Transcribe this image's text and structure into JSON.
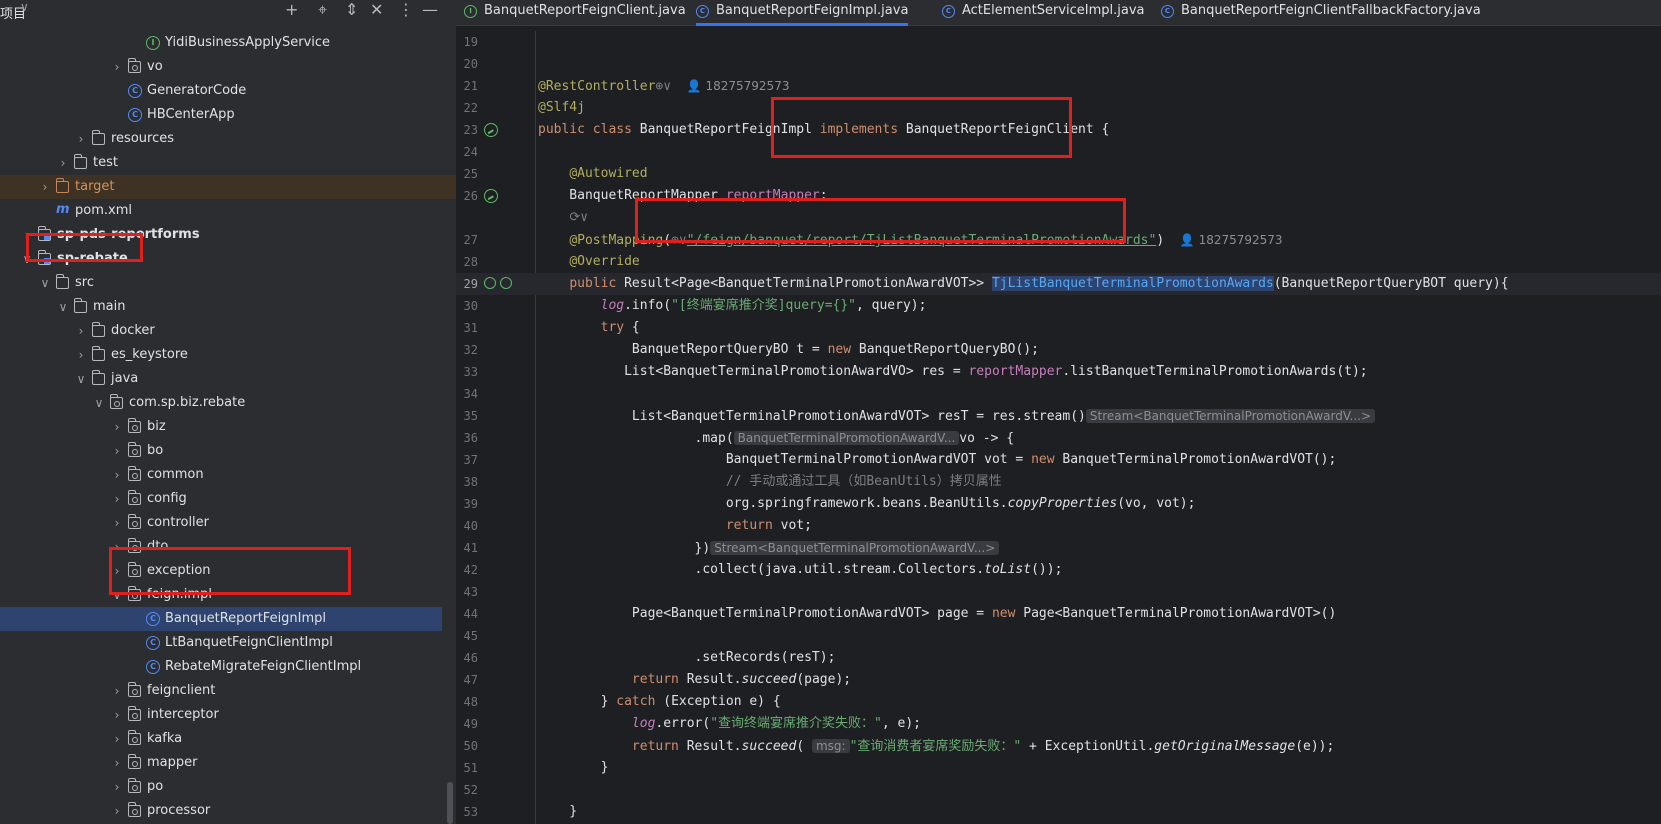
{
  "project": {
    "title": "项目",
    "title_chevron": "∨",
    "header_buttons": [
      "+",
      "⌖",
      "⇕",
      "✕",
      "⋮",
      "—"
    ],
    "tree": [
      {
        "label": "YidiBusinessApplyService",
        "icon": "interface-icon",
        "level": 8,
        "chevron": ""
      },
      {
        "label": "vo",
        "icon": "package-icon",
        "level": 7,
        "chevron": "›"
      },
      {
        "label": "GeneratorCode",
        "icon": "class-icon",
        "level": 7,
        "chevron": ""
      },
      {
        "label": "HBCenterApp",
        "icon": "class-icon",
        "level": 7,
        "chevron": ""
      },
      {
        "label": "resources",
        "icon": "folder-icon",
        "level": 5,
        "chevron": "›"
      },
      {
        "label": "test",
        "icon": "folder-icon",
        "level": 4,
        "chevron": "›"
      },
      {
        "label": "target",
        "icon": "target-folder-icon",
        "level": 3,
        "chevron": "›"
      },
      {
        "label": "pom.xml",
        "icon": "maven-icon",
        "level": 3,
        "chevron": ""
      },
      {
        "label": "sp-pds-reportforms",
        "icon": "module-icon",
        "level": 2,
        "chevron": "›"
      },
      {
        "label": "sp-rebate",
        "icon": "module-icon",
        "level": 2,
        "chevron": "∨"
      },
      {
        "label": "src",
        "icon": "folder-icon",
        "level": 3,
        "chevron": "∨"
      },
      {
        "label": "main",
        "icon": "folder-icon",
        "level": 4,
        "chevron": "∨"
      },
      {
        "label": "docker",
        "icon": "folder-icon",
        "level": 5,
        "chevron": "›"
      },
      {
        "label": "es_keystore",
        "icon": "folder-icon",
        "level": 5,
        "chevron": "›"
      },
      {
        "label": "java",
        "icon": "folder-icon",
        "level": 5,
        "chevron": "∨"
      },
      {
        "label": "com.sp.biz.rebate",
        "icon": "package-icon",
        "level": 6,
        "chevron": "∨"
      },
      {
        "label": "biz",
        "icon": "package-icon",
        "level": 7,
        "chevron": "›"
      },
      {
        "label": "bo",
        "icon": "package-icon",
        "level": 7,
        "chevron": "›"
      },
      {
        "label": "common",
        "icon": "package-icon",
        "level": 7,
        "chevron": "›"
      },
      {
        "label": "config",
        "icon": "package-icon",
        "level": 7,
        "chevron": "›"
      },
      {
        "label": "controller",
        "icon": "package-icon",
        "level": 7,
        "chevron": "›"
      },
      {
        "label": "dto",
        "icon": "package-icon",
        "level": 7,
        "chevron": "›"
      },
      {
        "label": "exception",
        "icon": "package-icon",
        "level": 7,
        "chevron": "›"
      },
      {
        "label": "feign.impl",
        "icon": "package-icon",
        "level": 7,
        "chevron": "∨"
      },
      {
        "label": "BanquetReportFeignImpl",
        "icon": "class-icon",
        "level": 8,
        "chevron": ""
      },
      {
        "label": "LtBanquetFeignClientImpl",
        "icon": "class-icon",
        "level": 8,
        "chevron": ""
      },
      {
        "label": "RebateMigrateFeignClientImpl",
        "icon": "class-icon",
        "level": 8,
        "chevron": ""
      },
      {
        "label": "feignclient",
        "icon": "package-icon",
        "level": 7,
        "chevron": "›"
      },
      {
        "label": "interceptor",
        "icon": "package-icon",
        "level": 7,
        "chevron": "›"
      },
      {
        "label": "kafka",
        "icon": "package-icon",
        "level": 7,
        "chevron": "›"
      },
      {
        "label": "mapper",
        "icon": "package-icon",
        "level": 7,
        "chevron": "›"
      },
      {
        "label": "po",
        "icon": "package-icon",
        "level": 7,
        "chevron": "›"
      },
      {
        "label": "processor",
        "icon": "package-icon",
        "level": 7,
        "chevron": "›"
      }
    ]
  },
  "tabs": [
    {
      "label": "BanquetReportFeignClient.java",
      "icon": "interface-icon",
      "active": false
    },
    {
      "label": "BanquetReportFeignImpl.java",
      "icon": "class-icon",
      "active": true
    },
    {
      "label": "ActElementServiceImpl.java",
      "icon": "class-icon",
      "active": false
    },
    {
      "label": "BanquetReportFeignClientFallbackFactory.java",
      "icon": "class-icon",
      "active": false
    }
  ],
  "code": {
    "author": "18275792573",
    "lines": [
      {
        "n": "19",
        "t": ""
      },
      {
        "n": "20",
        "t": ""
      },
      {
        "n": "21",
        "t": "<span class=\"an\">@RestController</span><span class=\"cm\">⊕∨</span>  <span class=\"author\">👤 18275792573</span>"
      },
      {
        "n": "22",
        "t": "<span class=\"an\">@Slf4j</span>"
      },
      {
        "n": "23",
        "t": "<span class=\"k\">public class</span> BanquetReportFeignImpl <span class=\"k\">implements</span> BanquetReportFeignClient {"
      },
      {
        "n": "24",
        "t": ""
      },
      {
        "n": "25",
        "t": "    <span class=\"an\">@Autowired</span>"
      },
      {
        "n": "26",
        "t": "    BanquetReportMapper <span class=\"f\">reportMapper</span>;"
      },
      {
        "n": "",
        "t": "    <span class=\"cm\">⟳∨</span>"
      },
      {
        "n": "27",
        "t": "    <span class=\"an\">@PostMapping</span>(<span class=\"cm\">⊕∨</span><span class=\"su\">\"/feign/banquet/report/TjListBanquetTerminalPromotionAwards\"</span>)  <span class=\"author\">👤 18275792573</span>"
      },
      {
        "n": "28",
        "t": "    <span class=\"an\">@Override</span>"
      },
      {
        "n": "29",
        "t": "    <span class=\"k\">public</span> Result&lt;Page&lt;BanquetTerminalPromotionAwardVOT&gt;&gt; <span class=\"mh\">TjListBanquetTerminalPromotionAwards</span>(BanquetReportQueryBOT query){"
      },
      {
        "n": "30",
        "t": "        <span class=\"lg\">log</span>.info(<span class=\"s\">\"[终端宴席推介奖]query={}\"</span>, query);"
      },
      {
        "n": "31",
        "t": "        <span class=\"k\">try</span> {"
      },
      {
        "n": "32",
        "t": "            BanquetReportQueryBO t = <span class=\"k\">new</span> BanquetReportQueryBO();"
      },
      {
        "n": "33",
        "t": "           List&lt;BanquetTerminalPromotionAwardVO&gt; res = <span class=\"f\">reportMapper</span>.listBanquetTerminalPromotionAwards(t);"
      },
      {
        "n": "34",
        "t": ""
      },
      {
        "n": "35",
        "t": "            List&lt;BanquetTerminalPromotionAwardVOT&gt; resT = res.stream()<span class=\"hint\">Stream&lt;BanquetTerminalPromotionAwardV...&gt;</span>"
      },
      {
        "n": "36",
        "t": "                    .map(<span class=\"hint\">BanquetTerminalPromotionAwardV...</span>vo -&gt; {"
      },
      {
        "n": "37",
        "t": "                        BanquetTerminalPromotionAwardVOT vot = <span class=\"k\">new</span> BanquetTerminalPromotionAwardVOT();"
      },
      {
        "n": "38",
        "t": "                        <span class=\"cm\">// 手动或通过工具（如BeanUtils）拷贝属性</span>"
      },
      {
        "n": "39",
        "t": "                        org.springframework.beans.BeanUtils.<span class=\"i\">copyProperties</span>(vo, vot);"
      },
      {
        "n": "40",
        "t": "                        <span class=\"k\">return</span> vot;"
      },
      {
        "n": "41",
        "t": "                    })<span class=\"hint\">Stream&lt;BanquetTerminalPromotionAwardV...&gt;</span>"
      },
      {
        "n": "42",
        "t": "                    .collect(java.util.stream.Collectors.<span class=\"i\">toList</span>());"
      },
      {
        "n": "43",
        "t": ""
      },
      {
        "n": "44",
        "t": "            Page&lt;BanquetTerminalPromotionAwardVOT&gt; page = <span class=\"k\">new</span> Page&lt;BanquetTerminalPromotionAwardVOT&gt;()"
      },
      {
        "n": "45",
        "t": ""
      },
      {
        "n": "46",
        "t": "                    .setRecords(resT);"
      },
      {
        "n": "47",
        "t": "            <span class=\"k\">return</span> Result.<span class=\"i\">succeed</span>(page);"
      },
      {
        "n": "48",
        "t": "        } <span class=\"k\">catch</span> (Exception e) {"
      },
      {
        "n": "49",
        "t": "            <span class=\"lg\">log</span>.error(<span class=\"s\">\"查询终端宴席推介奖失败：\"</span>, e);"
      },
      {
        "n": "50",
        "t": "            <span class=\"k\">return</span> Result.<span class=\"i\">succeed</span>( <span class=\"hint\">msg:</span><span class=\"s\">\"查询消费者宴席奖励失败：\"</span> + ExceptionUtil.<span class=\"i\">getOriginalMessage</span>(e));"
      },
      {
        "n": "51",
        "t": "        }"
      },
      {
        "n": "52",
        "t": ""
      },
      {
        "n": "53",
        "t": "    }"
      },
      {
        "n": "",
        "t": "}"
      }
    ]
  },
  "colors": {
    "accent": "#3574f0",
    "highlight_box": "#e0201d",
    "selection": "#2e436e"
  }
}
